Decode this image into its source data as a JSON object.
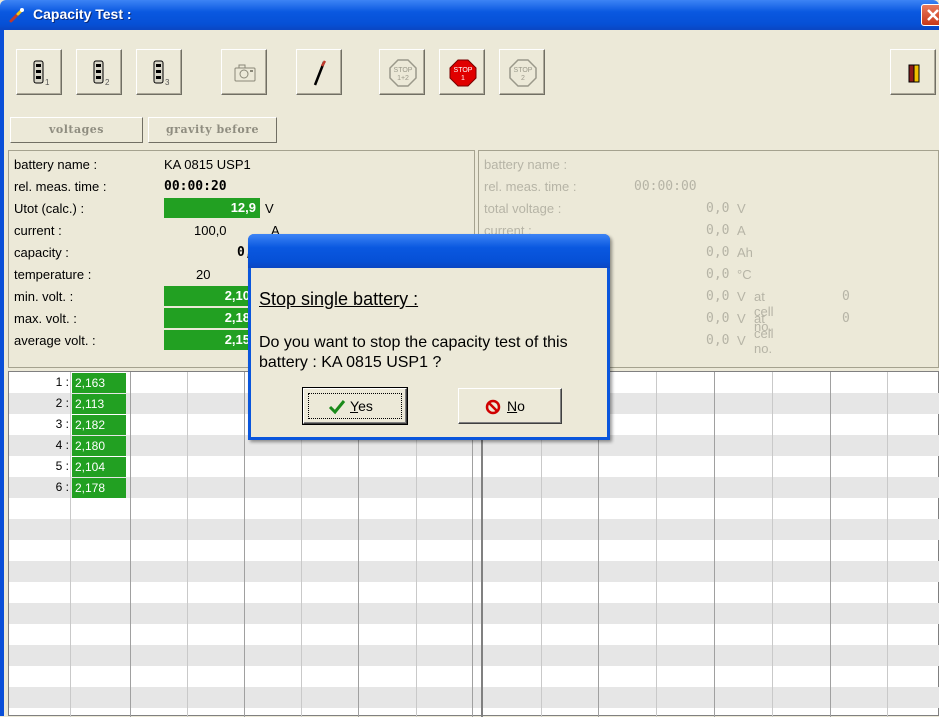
{
  "window": {
    "title": "Capacity Test :"
  },
  "tabs": [
    "voltages",
    "gravity before"
  ],
  "toolbar": {
    "battery_subscripts": [
      "1",
      "2",
      "3"
    ],
    "stop_labels": {
      "both": [
        "STOP",
        "1+2"
      ],
      "one": [
        "STOP",
        "1"
      ],
      "two": [
        "STOP",
        "2"
      ]
    }
  },
  "left_panel": {
    "battery_name_label": "battery name :",
    "battery_name": "KA 0815 USP1",
    "meas_time_label": "rel. meas. time :",
    "meas_time": "00:00:20",
    "utot_label": "Utot (calc.) :",
    "utot": "12,9",
    "utot_unit": "V",
    "current_label": "current :",
    "current": "100,0",
    "current_unit": "A",
    "capacity_label": "capacity :",
    "capacity": "0,",
    "temperature_label": "temperature :",
    "temperature": "20",
    "min_volt_label": "min. volt. :",
    "min_volt": "2,10",
    "max_volt_label": "max. volt. :",
    "max_volt": "2,18",
    "avg_volt_label": "average volt. :",
    "avg_volt": "2,15"
  },
  "right_panel": {
    "battery_name_label": "battery name :",
    "meas_time_label": "rel. meas. time :",
    "meas_time": "00:00:00",
    "total_voltage_label": "total voltage :",
    "total_voltage": "0,0",
    "total_voltage_unit": "V",
    "current_label": "current :",
    "current": "0,0",
    "current_unit": "A",
    "capacity": "0,0",
    "capacity_unit": "Ah",
    "temperature": "0,0",
    "temperature_unit": "°C",
    "min_volt": "0,0",
    "min_volt_unit": "V",
    "min_at_label": "at cell no.",
    "min_cell": "0",
    "max_volt": "0,0",
    "max_volt_unit": "V",
    "max_at_label": "at cell no.",
    "max_cell": "0",
    "avg_volt": "0,0",
    "avg_volt_unit": "V"
  },
  "cells": [
    {
      "idx": "1 :",
      "value": "2,163"
    },
    {
      "idx": "2 :",
      "value": "2,113"
    },
    {
      "idx": "3 :",
      "value": "2,182"
    },
    {
      "idx": "4 :",
      "value": "2,180"
    },
    {
      "idx": "5 :",
      "value": "2,104"
    },
    {
      "idx": "6 :",
      "value": "2,178"
    }
  ],
  "dialog": {
    "heading": "Stop single battery :",
    "message": "Do you want to stop the capacity test of this battery : KA 0815 USP1 ?",
    "yes_mnemonic": "Y",
    "yes_rest": "es",
    "no_mnemonic": "N",
    "no_rest": "o"
  },
  "colors": {
    "value_green": "#22a022",
    "titlebar_blue": "#0a58e0"
  }
}
